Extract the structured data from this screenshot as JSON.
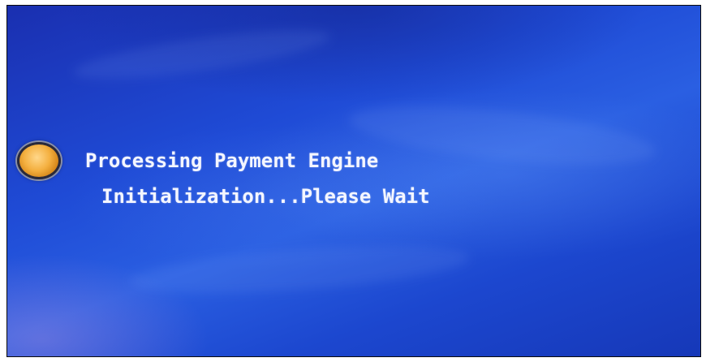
{
  "screen": {
    "status_icon": "orange-status-orb-icon",
    "message_line1": "Processing Payment Engine",
    "message_line2": "Initialization...Please Wait"
  },
  "colors": {
    "background": "#1f4bd6",
    "text": "#f4f6ff",
    "orb": "#f4b040"
  }
}
